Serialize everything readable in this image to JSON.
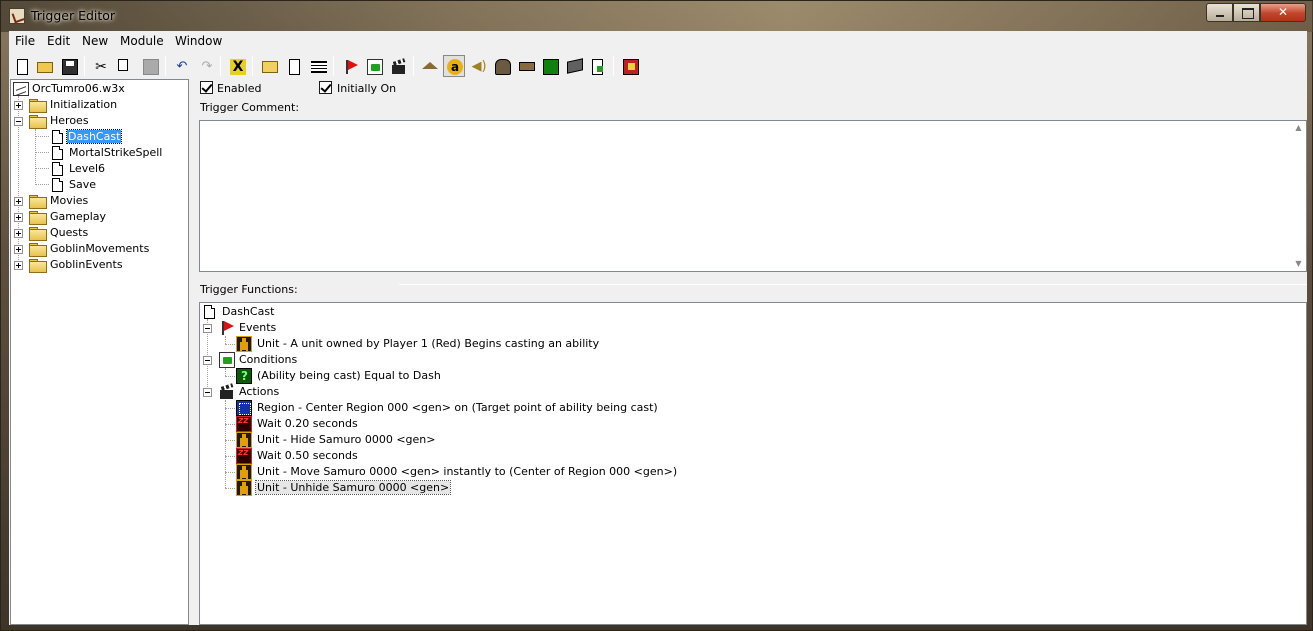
{
  "window": {
    "title": "Trigger Editor"
  },
  "menu": [
    "File",
    "Edit",
    "New",
    "Module",
    "Window"
  ],
  "toolbar_icons": [
    "new-icon",
    "open-icon",
    "save-icon",
    "cut-icon",
    "copy-icon",
    "paste-icon",
    "undo-icon",
    "redo-icon",
    "close-x-icon",
    "new-category-icon",
    "new-trigger-icon",
    "new-comment-icon",
    "new-event-icon",
    "new-condition-icon",
    "new-action-icon",
    "terrain-editor-icon",
    "trigger-editor-icon",
    "sound-editor-icon",
    "object-editor-icon",
    "campaign-editor-icon",
    "ai-editor-icon",
    "object-manager-icon",
    "import-manager-icon",
    "test-map-icon"
  ],
  "tree": {
    "root": "OrcTumro06.w3x",
    "items": [
      {
        "label": "Initialization",
        "type": "folder",
        "expanded": false
      },
      {
        "label": "Heroes",
        "type": "folder",
        "expanded": true,
        "children": [
          {
            "label": "DashCast",
            "selected": true
          },
          {
            "label": "MortalStrikeSpell"
          },
          {
            "label": "Level6"
          },
          {
            "label": "Save"
          }
        ]
      },
      {
        "label": "Movies",
        "type": "folder",
        "expanded": false
      },
      {
        "label": "Gameplay",
        "type": "folder",
        "expanded": false
      },
      {
        "label": "Quests",
        "type": "folder",
        "expanded": false
      },
      {
        "label": "GoblinMovements",
        "type": "folder",
        "expanded": false
      },
      {
        "label": "GoblinEvents",
        "type": "folder",
        "expanded": false
      }
    ]
  },
  "trigger": {
    "enabled_label": "Enabled",
    "initially_on_label": "Initially On",
    "comment_label": "Trigger Comment:",
    "comment_value": "",
    "functions_label": "Trigger Functions:",
    "name": "DashCast",
    "events_label": "Events",
    "conditions_label": "Conditions",
    "actions_label": "Actions",
    "events": [
      "Unit - A unit owned by Player 1 (Red) Begins casting an ability"
    ],
    "conditions": [
      "(Ability being cast) Equal to Dash"
    ],
    "actions": [
      "Region - Center Region 000 <gen> on (Target point of ability being cast)",
      "Wait 0.20 seconds",
      "Unit - Hide Samuro 0000 <gen>",
      "Wait 0.50 seconds",
      "Unit - Move Samuro 0000 <gen> instantly to (Center of Region 000 <gen>)",
      "Unit - Unhide Samuro 0000 <gen>"
    ]
  }
}
